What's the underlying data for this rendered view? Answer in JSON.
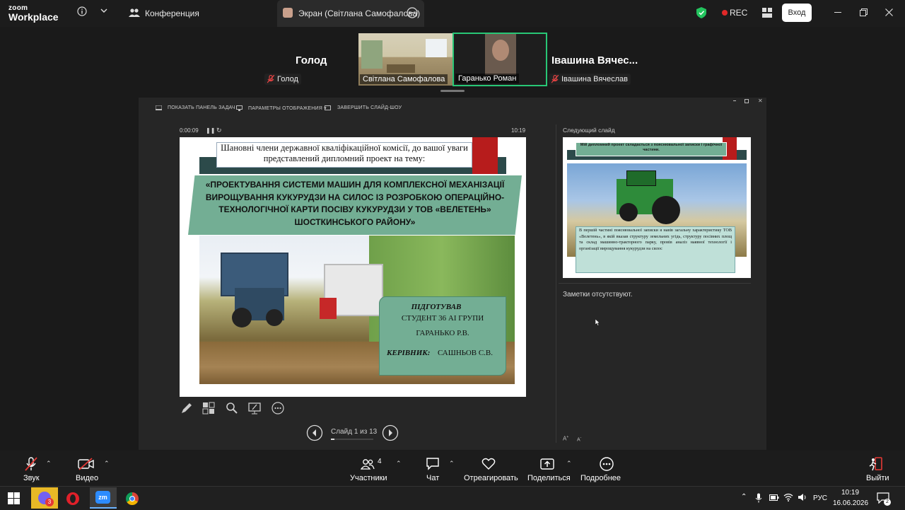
{
  "app": {
    "brand_small": "zoom",
    "brand_large": "Workplace"
  },
  "topbar": {
    "conference_label": "Конференция",
    "share_tab_label": "Экран (Світлана Самофалова)",
    "rec_label": "REC",
    "login_label": "Вход"
  },
  "participants": {
    "left_name": "Голод",
    "left_chip": "Голод",
    "video1_label": "Світлана Самофалова",
    "video2_label": "Гаранько Роман",
    "right_name": "Івашина  Вячес...",
    "right_chip": "Івашина Вячеслав"
  },
  "presenter": {
    "menu": [
      "ПОКАЗАТЬ ПАНЕЛЬ ЗАДАЧ",
      "ПАРАМЕТРЫ ОТОБРАЖЕНИЯ ▾",
      "ЗАВЕРШИТЬ СЛАЙД-ШОУ"
    ],
    "timer": "0:00:09",
    "clock": "10:19",
    "next_slide_label": "Следующий слайд",
    "notes": "Заметки отсутствуют.",
    "slide_counter": "Слайд 1 из 13"
  },
  "slide": {
    "intro": "Шановні члени державної кваліфікаційної комісії, до вашої уваги представлений дипломний проект на тему:",
    "title": "«ПРОЕКТУВАННЯ СИСТЕМИ МАШИН ДЛЯ КОМПЛЕКСНОЇ МЕХАНІЗАЦІЇ ВИРОЩУВАННЯ КУКУРУДЗИ НА СИЛОС ІЗ РОЗРОБКОЮ ОПЕРАЦІЙНО-ТЕХНОЛОГІЧНОЇ КАРТИ ПОСІВУ КУКУРУДЗИ У ТОВ «ВЕЛЕТЕНЬ» ШОСТКИНСЬКОГО РАЙОНУ»",
    "prepared_heading": "ПІДГОТУВАВ",
    "student_group": "СТУДЕНТ 36 АІ ГРУПИ",
    "student_name": "ГАРАНЬКО Р.В.",
    "supervisor_label": "КЕРІВНИК:",
    "supervisor_name": "САШНЬОВ С.В."
  },
  "next_slide": {
    "header": "Мій дипломний проект складається з пояснювальної записки і графічної частини.",
    "body": "В першій частині пояснювальної записки я навів загальну характеристику ТОВ «Велетень», в якій вказав структуру земельних угідь, структуру посівних площ та склад машинно-тракторного парку, провів аналіз наявної технології і організації вирощування кукурудзи на силос"
  },
  "toolbar": {
    "audio": "Звук",
    "video": "Видео",
    "participants": "Участники",
    "participants_count": "4",
    "chat": "Чат",
    "react": "Отреагировать",
    "share": "Поделиться",
    "more": "Подробнее",
    "leave": "Выйти"
  },
  "taskbar": {
    "badge": "3",
    "language": "РУС",
    "time": "10:19",
    "date": "16.06.2026",
    "notif_count": "2"
  }
}
